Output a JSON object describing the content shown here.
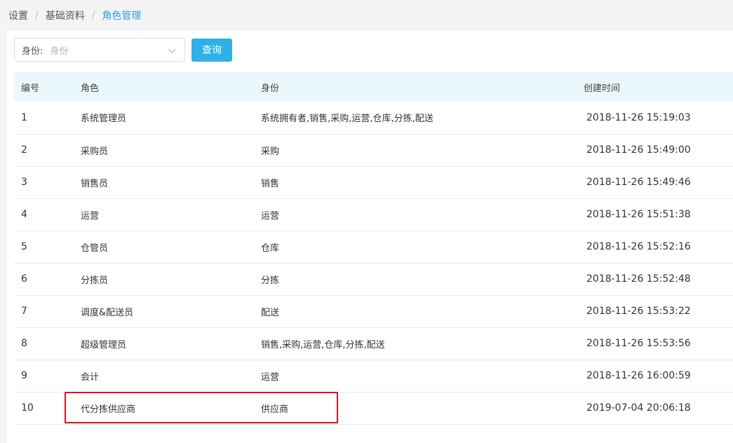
{
  "breadcrumb": {
    "items": [
      "设置",
      "基础资料",
      "角色管理"
    ],
    "separator": "/"
  },
  "filter": {
    "label": "身份:",
    "placeholder": "身份",
    "query_button": "查询"
  },
  "table": {
    "headers": [
      "编号",
      "角色",
      "身份",
      "创建时间"
    ],
    "rows": [
      {
        "id": "1",
        "role": "系统管理员",
        "identity": "系统拥有者,销售,采购,运营,仓库,分拣,配送",
        "created": "2018-11-26 15:19:03"
      },
      {
        "id": "2",
        "role": "采购员",
        "identity": "采购",
        "created": "2018-11-26 15:49:00"
      },
      {
        "id": "3",
        "role": "销售员",
        "identity": "销售",
        "created": "2018-11-26 15:49:46"
      },
      {
        "id": "4",
        "role": "运营",
        "identity": "运营",
        "created": "2018-11-26 15:51:38"
      },
      {
        "id": "5",
        "role": "仓管员",
        "identity": "仓库",
        "created": "2018-11-26 15:52:16"
      },
      {
        "id": "6",
        "role": "分拣员",
        "identity": "分拣",
        "created": "2018-11-26 15:52:48"
      },
      {
        "id": "7",
        "role": "调度&配送员",
        "identity": "配送",
        "created": "2018-11-26 15:53:22"
      },
      {
        "id": "8",
        "role": "超级管理员",
        "identity": "销售,采购,运营,仓库,分拣,配送",
        "created": "2018-11-26 15:53:56"
      },
      {
        "id": "9",
        "role": "会计",
        "identity": "运营",
        "created": "2018-11-26 16:00:59"
      },
      {
        "id": "10",
        "role": "代分拣供应商",
        "identity": "供应商",
        "created": "2019-07-04 20:06:18"
      }
    ]
  },
  "colors": {
    "accent": "#2eb1e6",
    "header_bg": "#eaf7fd",
    "highlight_border": "#e0131d"
  }
}
